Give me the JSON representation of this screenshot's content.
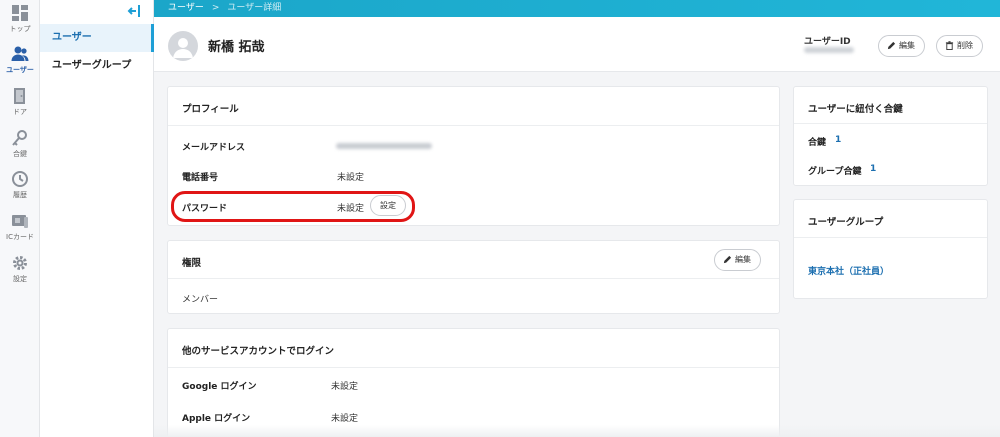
{
  "rail": [
    {
      "label": "トップ",
      "icon": "grid-icon"
    },
    {
      "label": "ユーザー",
      "icon": "users-icon",
      "active": true
    },
    {
      "label": "ドア",
      "icon": "door-icon"
    },
    {
      "label": "合鍵",
      "icon": "key-icon"
    },
    {
      "label": "履歴",
      "icon": "history-icon"
    },
    {
      "label": "ICカード",
      "icon": "card-icon"
    },
    {
      "label": "設定",
      "icon": "gear-icon"
    }
  ],
  "subnav": {
    "items": [
      {
        "label": "ユーザー",
        "active": true
      },
      {
        "label": "ユーザーグループ"
      }
    ]
  },
  "breadcrumb": {
    "root": "ユーザー",
    "separator": ">",
    "current": "ユーザー詳細"
  },
  "user": {
    "name": "新橋 拓哉",
    "id_label": "ユーザーID",
    "edit_label": "編集",
    "delete_label": "削除"
  },
  "profile": {
    "title": "プロフィール",
    "email_label": "メールアドレス",
    "phone_label": "電話番号",
    "phone_value": "未設定",
    "password_label": "パスワード",
    "password_value": "未設定",
    "password_button": "設定"
  },
  "permission": {
    "title": "権限",
    "edit_label": "編集",
    "value": "メンバー"
  },
  "sso": {
    "title": "他のサービスアカウントでログイン",
    "google_label": "Google ログイン",
    "google_value": "未設定",
    "apple_label": "Apple ログイン",
    "apple_value": "未設定"
  },
  "keys": {
    "title": "ユーザーに紐付く合鍵",
    "key_label": "合鍵",
    "key_count": "1",
    "group_key_label": "グループ合鍵",
    "group_key_count": "1"
  },
  "groups": {
    "title": "ユーザーグループ",
    "item": "東京本社（正社員）"
  },
  "colors": {
    "accent": "#1ba6c9",
    "link": "#1c6fb0",
    "highlight": "#e01515"
  }
}
